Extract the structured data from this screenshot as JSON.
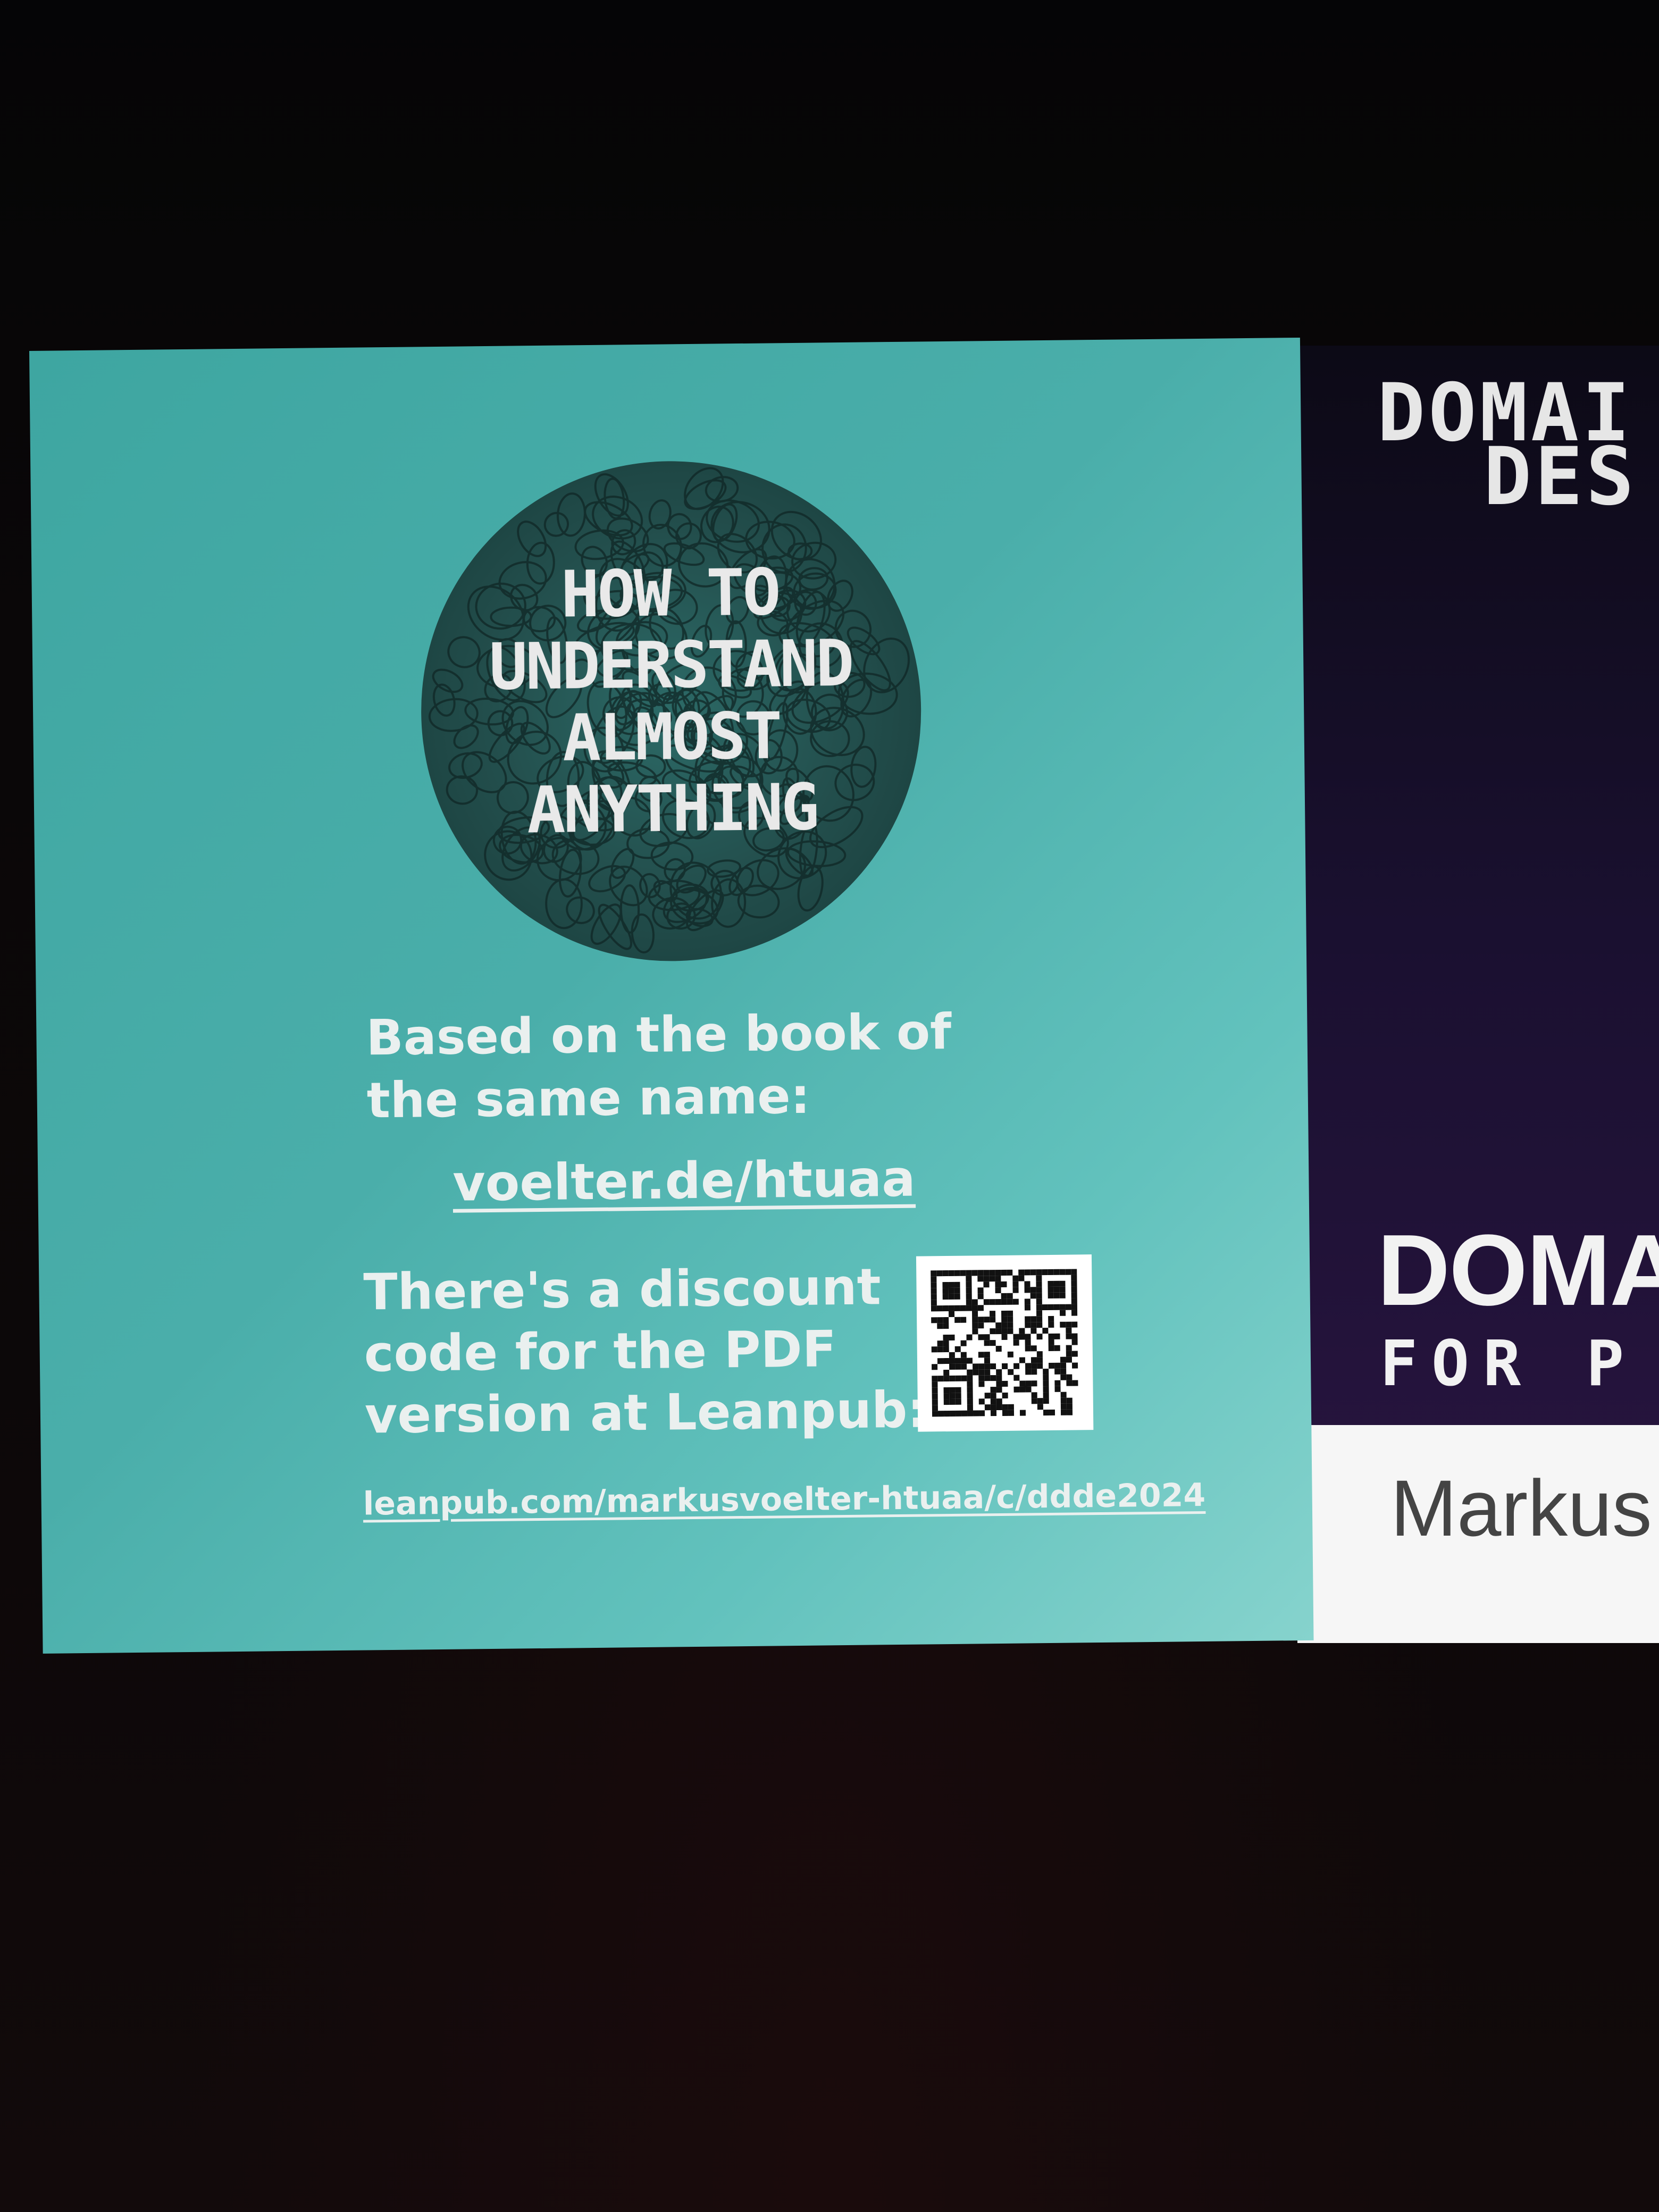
{
  "left_slide": {
    "logo_words": [
      "HOW TO",
      "UNDERSTAND",
      "ALMOST",
      "ANYTHING"
    ],
    "book_intro_lines": [
      "Based on the book of",
      "the same name:"
    ],
    "book_link": "voelter.de/htuaa",
    "discount_lines": [
      "There's a discount",
      "code for the PDF",
      "version at Leanpub:"
    ],
    "leanpub_link": "leanpub.com/markusvoelter-htuaa/c/ddde2024",
    "background_color": "#4aaeaa"
  },
  "right_slide": {
    "top_title_lines": [
      "DOMAI",
      "DES"
    ],
    "bottom_title": "DOMA",
    "bottom_subtitle": "FOR P",
    "speaker_name": "Markus"
  }
}
